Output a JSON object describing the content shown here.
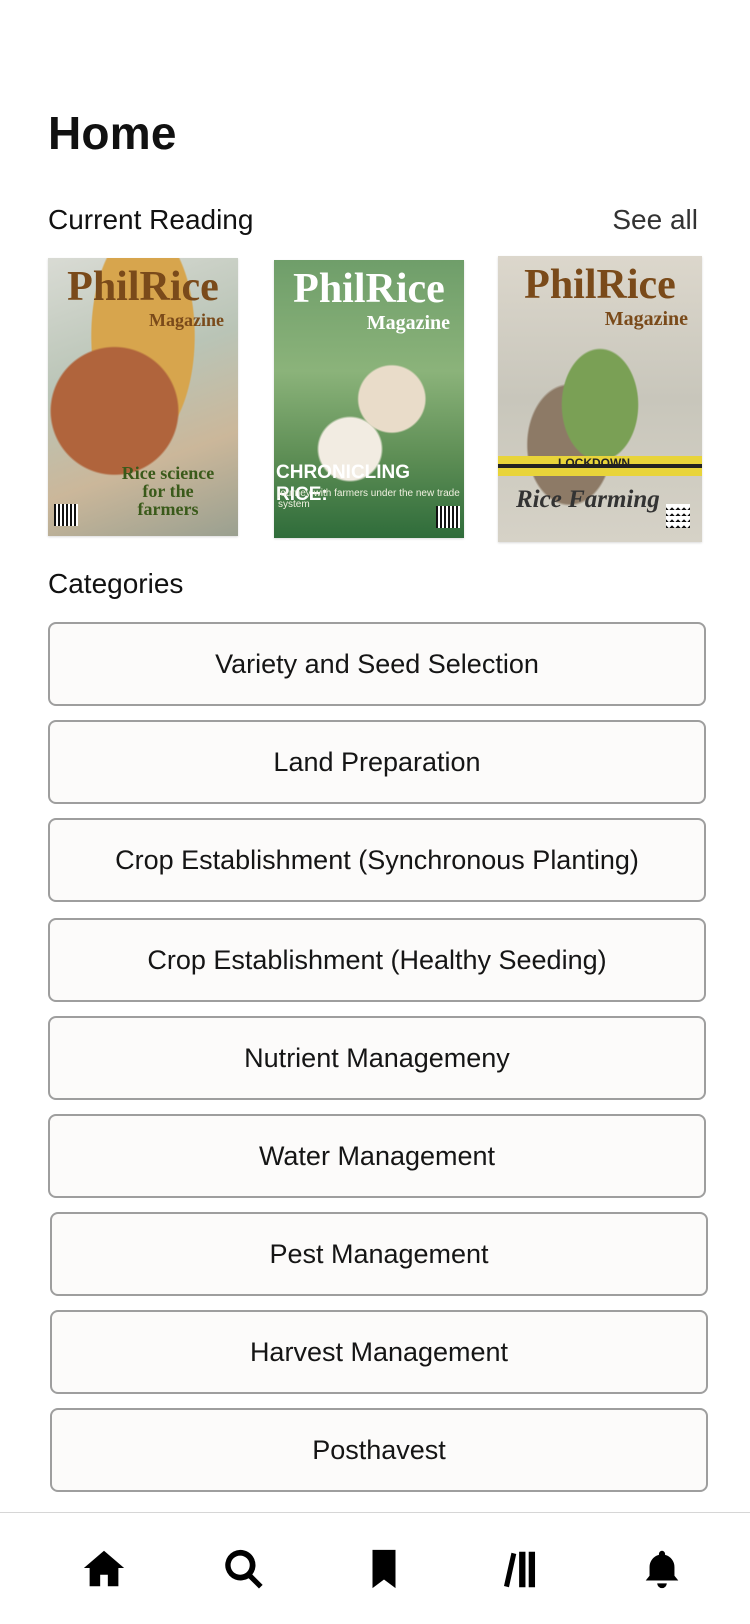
{
  "page": {
    "title": "Home"
  },
  "current_reading": {
    "title": "Current Reading",
    "see_all_label": "See all",
    "covers": [
      {
        "masthead": "PhilRice",
        "subtitle": "Magazine",
        "tagline": "Rice science for the farmers"
      },
      {
        "masthead": "PhilRice",
        "subtitle": "Magazine",
        "tagline": "CHRONICLING RICE:",
        "subline": "journey with farmers under the new trade system"
      },
      {
        "masthead": "PhilRice",
        "subtitle": "Magazine",
        "banner": "LOCKDOWN",
        "tagline": "Rice Farming"
      }
    ]
  },
  "categories": {
    "title": "Categories",
    "items": [
      {
        "label": "Variety and Seed Selection"
      },
      {
        "label": "Land Preparation"
      },
      {
        "label": "Crop Establishment (Synchronous Planting)"
      },
      {
        "label": "Crop Establishment (Healthy Seeding)"
      },
      {
        "label": "Nutrient Managemeny"
      },
      {
        "label": "Water Management"
      },
      {
        "label": "Pest Management"
      },
      {
        "label": "Harvest Management"
      },
      {
        "label": "Posthavest"
      }
    ]
  },
  "bottom_nav": [
    {
      "icon": "home-icon"
    },
    {
      "icon": "search-icon"
    },
    {
      "icon": "bookmark-icon"
    },
    {
      "icon": "library-icon"
    },
    {
      "icon": "bell-icon"
    }
  ]
}
